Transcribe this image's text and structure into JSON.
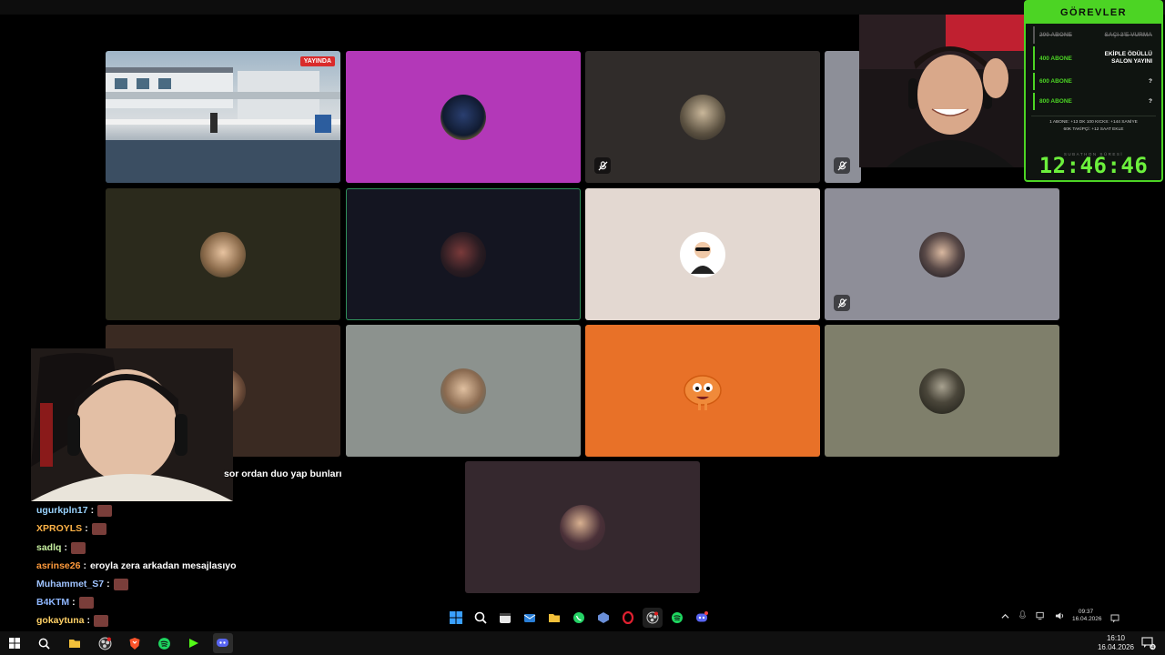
{
  "colors": {
    "accent_green": "#4cd424",
    "timer_green": "#6cf03c",
    "live_red": "#d92b2b",
    "tiles": [
      "#b338b8",
      "#302c2a",
      "#8d8f98",
      "#2b2a1c",
      "#141521",
      "#e3d8d1",
      "#8e8e98",
      "#3a2a22",
      "#8c928e",
      "#e87128",
      "#7f7f6b",
      "#35282e"
    ]
  },
  "stream_preview": {
    "live_label": "YAYINDA"
  },
  "gorevler": {
    "title": "GÖREVLER",
    "tasks": [
      {
        "left": "200 ABONE",
        "right": "SAÇI 3'E VURMA",
        "done": true
      },
      {
        "left": "400 ABONE",
        "right": "EKİPLE ÖDÜLLÜ SALON YAYINI",
        "done": false
      },
      {
        "left": "600 ABONE",
        "right": "?",
        "done": false
      },
      {
        "left": "800 ABONE",
        "right": "?",
        "done": false
      }
    ],
    "info_line1": "1 ABONE: +13 DK  100 KICKS: +144 SANİYE",
    "info_line2": "60K TAKİPÇİ: +12 SAAT EKLE",
    "timer_label": "SUBATHON SÜRESİ",
    "timer": "12:46:46"
  },
  "chat": [
    {
      "user": "",
      "message": "sor ordan duo yap bunları",
      "user_color": "#ffffff",
      "emote": false
    },
    {
      "user": "ugurkpln17",
      "message": "",
      "user_color": "#9ad4ff",
      "emote": true
    },
    {
      "user": "XPROYLS",
      "message": "",
      "user_color": "#ffb347",
      "emote": true
    },
    {
      "user": "sadlq",
      "message": "",
      "user_color": "#c7f0a0",
      "emote": true
    },
    {
      "user": "asrinse26",
      "message": "eroyla zera arkadan mesajlasıyo",
      "user_color": "#ff9a3c",
      "emote": false
    },
    {
      "user": "Muhammet_S7",
      "message": "",
      "user_color": "#9fc3ff",
      "emote": true
    },
    {
      "user": "B4KTM",
      "message": "",
      "user_color": "#8fb7ff",
      "emote": true
    },
    {
      "user": "gokaytuna",
      "message": "",
      "user_color": "#ffd166",
      "emote": true
    }
  ],
  "inner_clock": {
    "time": "09:37",
    "date": "16.04.2026"
  },
  "clock": {
    "time": "16:10",
    "date": "16.04.2026"
  },
  "notification_count": "4"
}
